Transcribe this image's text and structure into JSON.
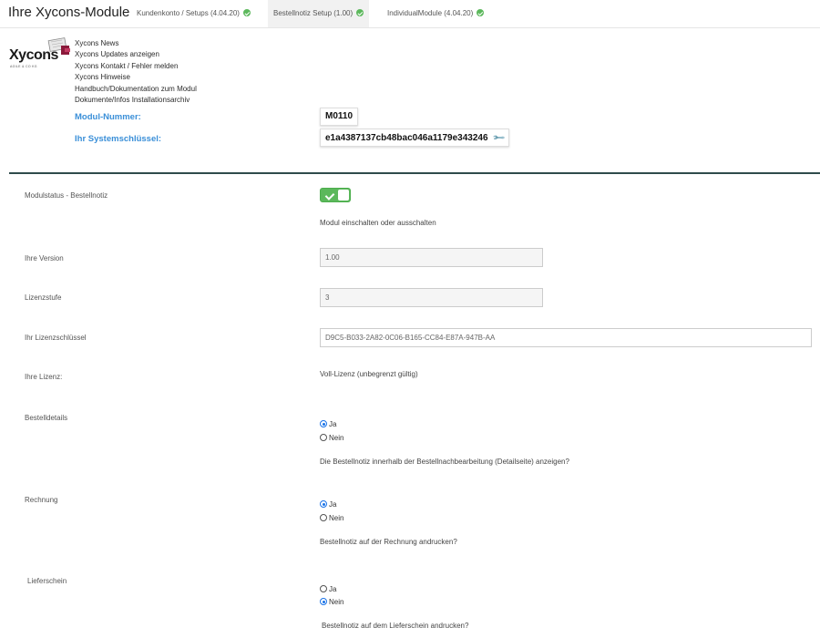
{
  "header": {
    "title": "Ihre Xycons-Module",
    "tabs": [
      {
        "label": "Kundenkonto / Setups (4.04.20)"
      },
      {
        "label": "Bestellnotiz Setup (1.00)"
      },
      {
        "label": "IndividualModule (4.04.20)"
      }
    ]
  },
  "logo": {
    "word": "Xycons",
    "sub": "AGILE & CO KG"
  },
  "links": [
    "Xycons News",
    "Xycons Updates anzeigen",
    "Xycons Kontakt / Fehler melden",
    "Xycons Hinweise",
    "Handbuch/Dokumentation zum Modul",
    "Dokumente/Infos Installationsarchiv"
  ],
  "module": {
    "number_label": "Modul-Nummer:",
    "number_value": "M0110",
    "key_label": "Ihr Systemschlüssel:",
    "key_value": "e1a4387137cb48bac046a1179e343246"
  },
  "form": {
    "status_label": "Modulstatus - Bestellnotiz",
    "status_on": true,
    "status_help": "Modul einschalten oder ausschalten",
    "version_label": "Ihre Version",
    "version_value": "1.00",
    "level_label": "Lizenzstufe",
    "level_value": "3",
    "licensekey_label": "Ihr Lizenzschlüssel",
    "licensekey_value": "D9C5-B033-2A82-0C06-B165-CC84-E87A-947B-AA",
    "license_label": "Ihre Lizenz:",
    "license_value": "Voll-Lizenz (unbegrenzt gültig)",
    "orderdetails_label": "Bestelldetails",
    "orderdetails_help": "Die Bestellnotiz innerhalb der Bestellnachbearbeitung (Detailseite) anzeigen?",
    "invoice_label": "Rechnung",
    "invoice_help": "Bestellnotiz auf der Rechnung andrucken?",
    "delivery_label": "Lieferschein",
    "delivery_help": "Bestellnotiz auf dem Lieferschein andrucken?",
    "yes": "Ja",
    "no": "Nein"
  }
}
